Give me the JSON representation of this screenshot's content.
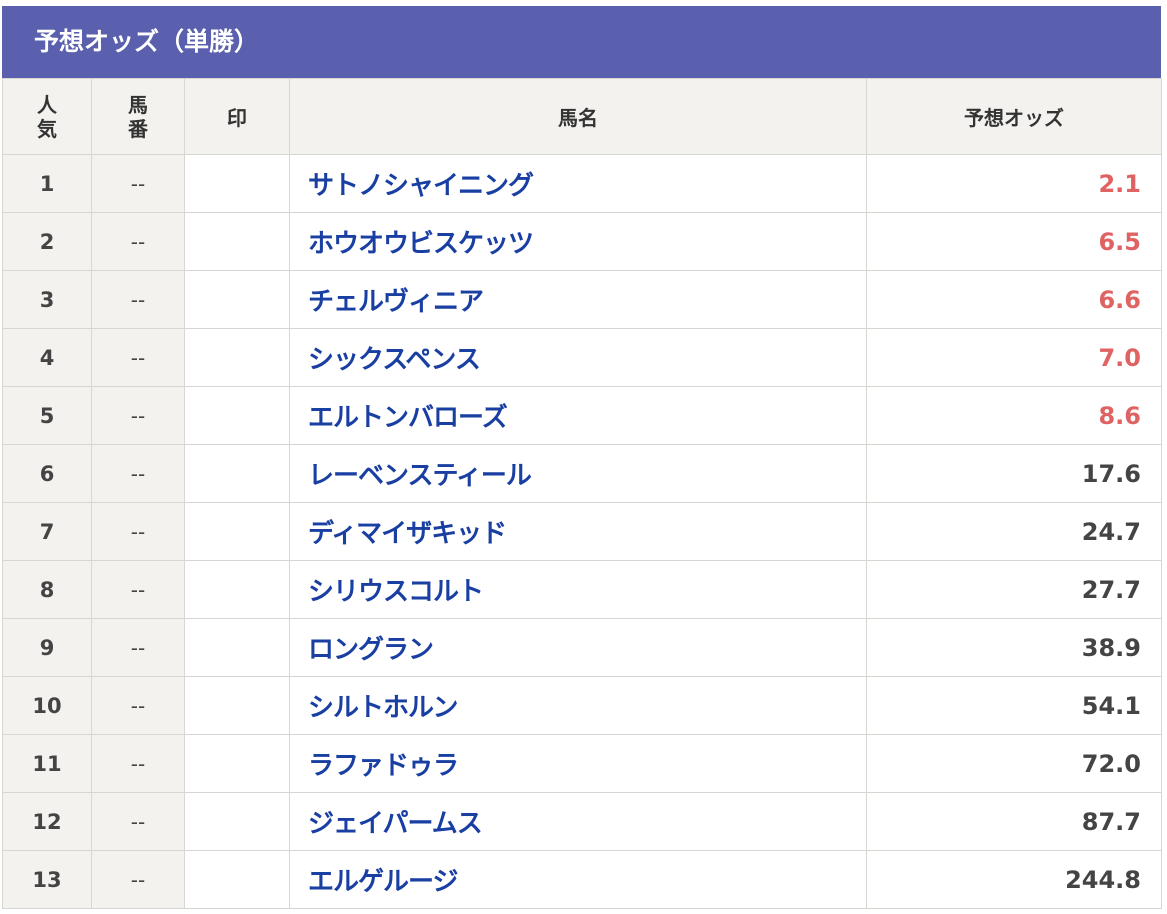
{
  "title": "予想オッズ（単勝）",
  "headers": {
    "rank": [
      "人",
      "気"
    ],
    "umaban": [
      "馬",
      "番"
    ],
    "mark": "印",
    "name": "馬名",
    "odds": "予想オッズ"
  },
  "colors": {
    "title_bg": "#5a5fae",
    "header_bg": "#f3f2ee",
    "horse_name": "#1a3fa3",
    "favorite_odds": "#e06363",
    "normal_odds": "#444444"
  },
  "rows": [
    {
      "rank": "1",
      "umaban": "--",
      "mark": "",
      "name": "サトノシャイニング",
      "odds": "2.1",
      "favorite": true
    },
    {
      "rank": "2",
      "umaban": "--",
      "mark": "",
      "name": "ホウオウビスケッツ",
      "odds": "6.5",
      "favorite": true
    },
    {
      "rank": "3",
      "umaban": "--",
      "mark": "",
      "name": "チェルヴィニア",
      "odds": "6.6",
      "favorite": true
    },
    {
      "rank": "4",
      "umaban": "--",
      "mark": "",
      "name": "シックスペンス",
      "odds": "7.0",
      "favorite": true
    },
    {
      "rank": "5",
      "umaban": "--",
      "mark": "",
      "name": "エルトンバローズ",
      "odds": "8.6",
      "favorite": true
    },
    {
      "rank": "6",
      "umaban": "--",
      "mark": "",
      "name": "レーベンスティール",
      "odds": "17.6",
      "favorite": false
    },
    {
      "rank": "7",
      "umaban": "--",
      "mark": "",
      "name": "ディマイザキッド",
      "odds": "24.7",
      "favorite": false
    },
    {
      "rank": "8",
      "umaban": "--",
      "mark": "",
      "name": "シリウスコルト",
      "odds": "27.7",
      "favorite": false
    },
    {
      "rank": "9",
      "umaban": "--",
      "mark": "",
      "name": "ロングラン",
      "odds": "38.9",
      "favorite": false
    },
    {
      "rank": "10",
      "umaban": "--",
      "mark": "",
      "name": "シルトホルン",
      "odds": "54.1",
      "favorite": false
    },
    {
      "rank": "11",
      "umaban": "--",
      "mark": "",
      "name": "ラファドゥラ",
      "odds": "72.0",
      "favorite": false
    },
    {
      "rank": "12",
      "umaban": "--",
      "mark": "",
      "name": "ジェイパームス",
      "odds": "87.7",
      "favorite": false
    },
    {
      "rank": "13",
      "umaban": "--",
      "mark": "",
      "name": "エルゲルージ",
      "odds": "244.8",
      "favorite": false
    }
  ]
}
